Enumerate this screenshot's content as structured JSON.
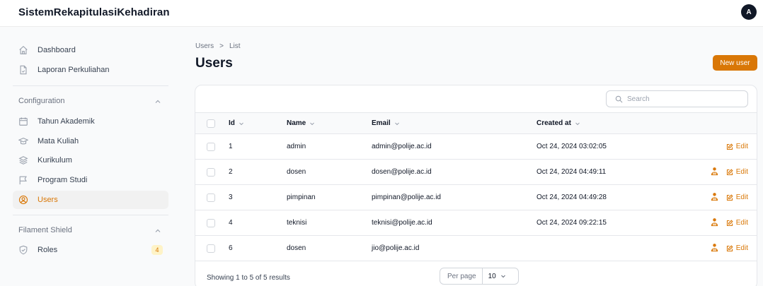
{
  "app": {
    "brand": "SistemRekapitulasiKehadiran",
    "avatar_initial": "A"
  },
  "sidebar": {
    "top_items": [
      {
        "label": "Dashboard",
        "icon": "home-icon"
      },
      {
        "label": "Laporan Perkuliahan",
        "icon": "document-icon"
      }
    ],
    "groups": [
      {
        "label": "Configuration",
        "items": [
          {
            "label": "Tahun Akademik",
            "icon": "calendar-icon"
          },
          {
            "label": "Mata Kuliah",
            "icon": "academic-cap-icon"
          },
          {
            "label": "Kurikulum",
            "icon": "stack-icon"
          },
          {
            "label": "Program Studi",
            "icon": "flag-icon"
          },
          {
            "label": "Users",
            "icon": "user-circle-icon",
            "active": true
          }
        ]
      },
      {
        "label": "Filament Shield",
        "items": [
          {
            "label": "Roles",
            "icon": "shield-check-icon",
            "badge": "4"
          }
        ]
      }
    ]
  },
  "header": {
    "breadcrumb": [
      "Users",
      "List"
    ],
    "breadcrumb_separator": ">",
    "title": "Users",
    "new_button_label": "New user"
  },
  "table": {
    "search_placeholder": "Search",
    "columns": [
      "Id",
      "Name",
      "Email",
      "Created at"
    ],
    "rows": [
      {
        "id": "1",
        "name": "admin",
        "email": "admin@polije.ac.id",
        "created_at": "Oct 24, 2024 03:02:05",
        "has_shield": false
      },
      {
        "id": "2",
        "name": "dosen",
        "email": "dosen@polije.ac.id",
        "created_at": "Oct 24, 2024 04:49:11",
        "has_shield": true
      },
      {
        "id": "3",
        "name": "pimpinan",
        "email": "pimpinan@polije.ac.id",
        "created_at": "Oct 24, 2024 04:49:28",
        "has_shield": true
      },
      {
        "id": "4",
        "name": "teknisi",
        "email": "teknisi@polije.ac.id",
        "created_at": "Oct 24, 2024 09:22:15",
        "has_shield": true
      },
      {
        "id": "6",
        "name": "dosen",
        "email": "jio@polije.ac.id",
        "created_at": "",
        "has_shield": true
      }
    ],
    "edit_label": "Edit",
    "showing_text": "Showing 1 to 5 of 5 results",
    "per_page_label": "Per page",
    "per_page_value": "10"
  },
  "colors": {
    "accent": "#d97706",
    "accent_bg": "#fef3c7",
    "active_bg": "#f1f1f1"
  }
}
